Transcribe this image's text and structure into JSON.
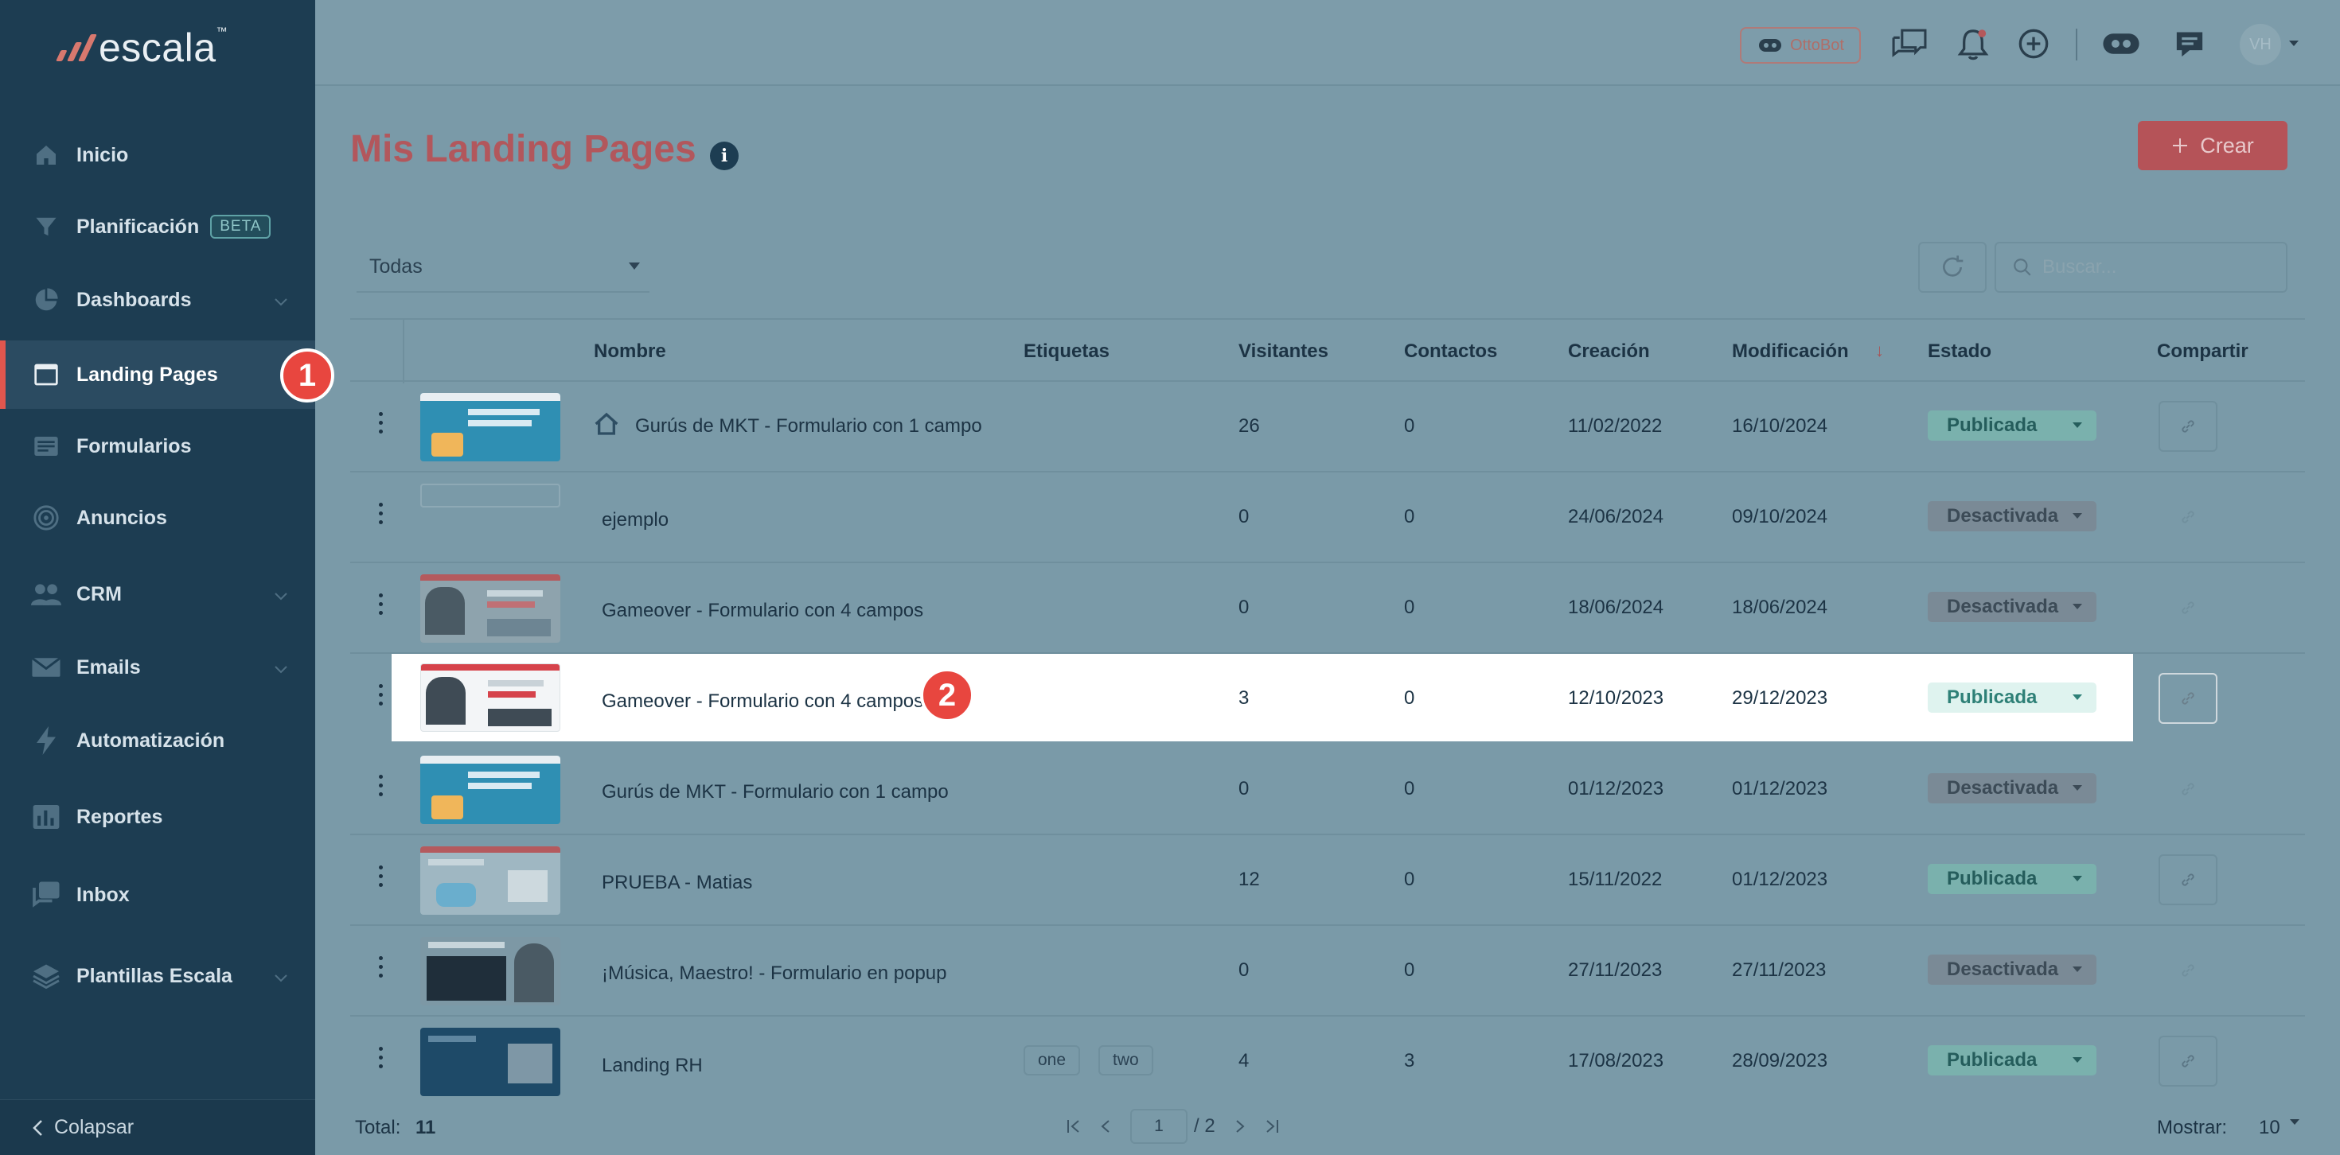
{
  "brand": {
    "name": "escala",
    "tm": "™"
  },
  "sidebar": {
    "items": [
      {
        "label": "Inicio",
        "icon": "home-icon"
      },
      {
        "label": "Planificación",
        "icon": "filter-icon",
        "badge": "BETA"
      },
      {
        "label": "Dashboards",
        "icon": "pie-chart-icon",
        "expandable": true
      },
      {
        "label": "Landing Pages",
        "icon": "browser-window-icon",
        "active": true
      },
      {
        "label": "Formularios",
        "icon": "form-icon"
      },
      {
        "label": "Anuncios",
        "icon": "target-icon"
      },
      {
        "label": "CRM",
        "icon": "users-icon",
        "expandable": true
      },
      {
        "label": "Emails",
        "icon": "mail-icon",
        "expandable": true
      },
      {
        "label": "Automatización",
        "icon": "lightning-icon"
      },
      {
        "label": "Reportes",
        "icon": "bar-chart-icon"
      },
      {
        "label": "Inbox",
        "icon": "inbox-icon"
      },
      {
        "label": "Plantillas Escala",
        "icon": "layers-icon",
        "expandable": true
      }
    ],
    "collapse_label": "Colapsar"
  },
  "steps": {
    "one": "1",
    "two": "2"
  },
  "topbar": {
    "ottobot_label": "OttoBot",
    "avatar_initials": "VH"
  },
  "page": {
    "title": "Mis Landing Pages",
    "create_label": "Crear",
    "filter_value": "Todas",
    "search_placeholder": "Buscar..."
  },
  "table": {
    "headers": {
      "nombre": "Nombre",
      "etiquetas": "Etiquetas",
      "visitantes": "Visitantes",
      "contactos": "Contactos",
      "creacion": "Creación",
      "modificacion": "Modificación",
      "estado": "Estado",
      "compartir": "Compartir"
    },
    "rows": [
      {
        "name": "Gurús de MKT - Formulario con 1 campo",
        "home": true,
        "tags": [],
        "visitors": "26",
        "contacts": "0",
        "created": "11/02/2022",
        "modified": "16/10/2024",
        "status": "Publicada"
      },
      {
        "name": "ejemplo",
        "tags": [],
        "visitors": "0",
        "contacts": "0",
        "created": "24/06/2024",
        "modified": "09/10/2024",
        "status": "Desactivada"
      },
      {
        "name": "Gameover - Formulario con 4 campos",
        "tags": [],
        "visitors": "0",
        "contacts": "0",
        "created": "18/06/2024",
        "modified": "18/06/2024",
        "status": "Desactivada"
      },
      {
        "name": "Gameover - Formulario con 4 campos",
        "tags": [],
        "visitors": "3",
        "contacts": "0",
        "created": "12/10/2023",
        "modified": "29/12/2023",
        "status": "Publicada",
        "highlighted": true
      },
      {
        "name": "Gurús de MKT - Formulario con 1 campo",
        "tags": [],
        "visitors": "0",
        "contacts": "0",
        "created": "01/12/2023",
        "modified": "01/12/2023",
        "status": "Desactivada"
      },
      {
        "name": "PRUEBA - Matias",
        "tags": [],
        "visitors": "12",
        "contacts": "0",
        "created": "15/11/2022",
        "modified": "01/12/2023",
        "status": "Publicada"
      },
      {
        "name": "¡Música, Maestro! - Formulario en popup",
        "tags": [],
        "visitors": "0",
        "contacts": "0",
        "created": "27/11/2023",
        "modified": "27/11/2023",
        "status": "Desactivada"
      },
      {
        "name": "Landing RH",
        "tags": [
          "one",
          "two"
        ],
        "visitors": "4",
        "contacts": "3",
        "created": "17/08/2023",
        "modified": "28/09/2023",
        "status": "Publicada"
      }
    ]
  },
  "footer": {
    "total_label": "Total:",
    "total_value": "11",
    "page_current": "1",
    "page_total": "/ 2",
    "show_label": "Mostrar:",
    "show_value": "10"
  },
  "colors": {
    "accent": "#e0564e",
    "sidebar": "#1d3d52",
    "published": "#2e8077"
  }
}
